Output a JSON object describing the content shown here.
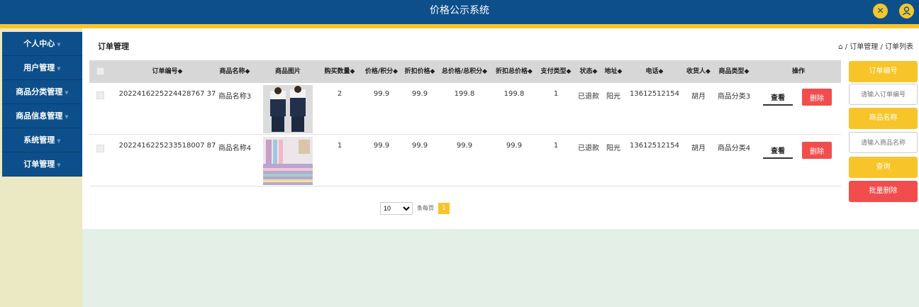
{
  "header": {
    "title": "价格公示系统",
    "icons": [
      "shrink-icon",
      "user-icon"
    ]
  },
  "sidebar": {
    "items": [
      {
        "label": "个人中心"
      },
      {
        "label": "用户管理"
      },
      {
        "label": "商品分类管理"
      },
      {
        "label": "商品信息管理"
      },
      {
        "label": "系统管理"
      },
      {
        "label": "订单管理"
      }
    ]
  },
  "main": {
    "title": "订单管理",
    "breadcrumb": "订单管理 / 订单列表"
  },
  "table": {
    "columns": [
      "订单编号◆",
      "商品名称◆",
      "商品图片",
      "购买数量◆",
      "价格/积分◆",
      "折扣价格◆",
      "总价格/总积分◆",
      "折扣总价格◆",
      "支付类型◆",
      "状态◆",
      "地址◆",
      "电话◆",
      "收货人◆",
      "商品类型◆",
      "操作"
    ],
    "rows": [
      {
        "order_no": "2022416225224428767 37",
        "name": "商品名称3",
        "qty": "2",
        "price": "99.9",
        "discount_price": "99.9",
        "total": "199.8",
        "discount_total": "199.8",
        "pay_type": "1",
        "status": "已退款",
        "address": "阳光",
        "phone": "13612512154",
        "receiver": "胡月",
        "category": "商品分类3",
        "image": "photo-couple-uniforms"
      },
      {
        "order_no": "2022416225233518007 87",
        "name": "商品名称4",
        "qty": "1",
        "price": "99.9",
        "discount_price": "99.9",
        "total": "99.9",
        "discount_total": "99.9",
        "pay_type": "1",
        "status": "已退款",
        "address": "阳光",
        "phone": "13612512154",
        "receiver": "胡月",
        "category": "商品分类4",
        "image": "photo-bedding"
      }
    ],
    "view_label": "查看",
    "delete_label": "删除"
  },
  "pagination": {
    "page_size": "10",
    "per_page_label": "条每页",
    "current_page": "1"
  },
  "search_panel": {
    "order_no_label": "订单编号",
    "order_no_placeholder": "请输入订单编号",
    "name_label": "商品名称",
    "name_placeholder": "请输入商品名称",
    "query_label": "查询",
    "batch_delete_label": "批量删除"
  },
  "colors": {
    "primary": "#0d4f8b",
    "accent": "#f7c52a",
    "danger": "#f24d4d"
  }
}
